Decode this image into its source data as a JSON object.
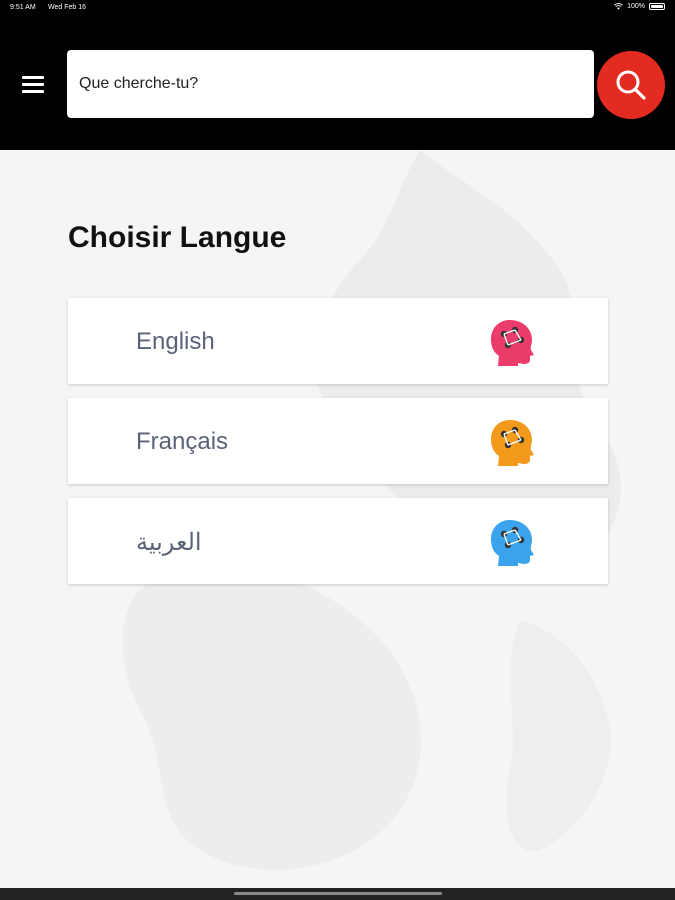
{
  "status_bar": {
    "time": "9:51 AM",
    "date": "Wed Feb 16",
    "battery": "100%"
  },
  "header": {
    "search_placeholder": "Que cherche-tu?",
    "search_icon": "magnifier-icon",
    "menu_icon": "hamburger-menu-icon"
  },
  "main": {
    "title": "Choisir Langue",
    "languages": [
      {
        "label": "English",
        "icon": "brain-head-icon",
        "color": "#ec3c6b"
      },
      {
        "label": "Français",
        "icon": "brain-head-icon",
        "color": "#f39a1d"
      },
      {
        "label": "العربية",
        "icon": "brain-head-icon",
        "color": "#3aa3ec"
      }
    ]
  },
  "colors": {
    "accent": "#e32b22",
    "header_bg": "#000000",
    "page_bg": "#f5f5f5"
  }
}
